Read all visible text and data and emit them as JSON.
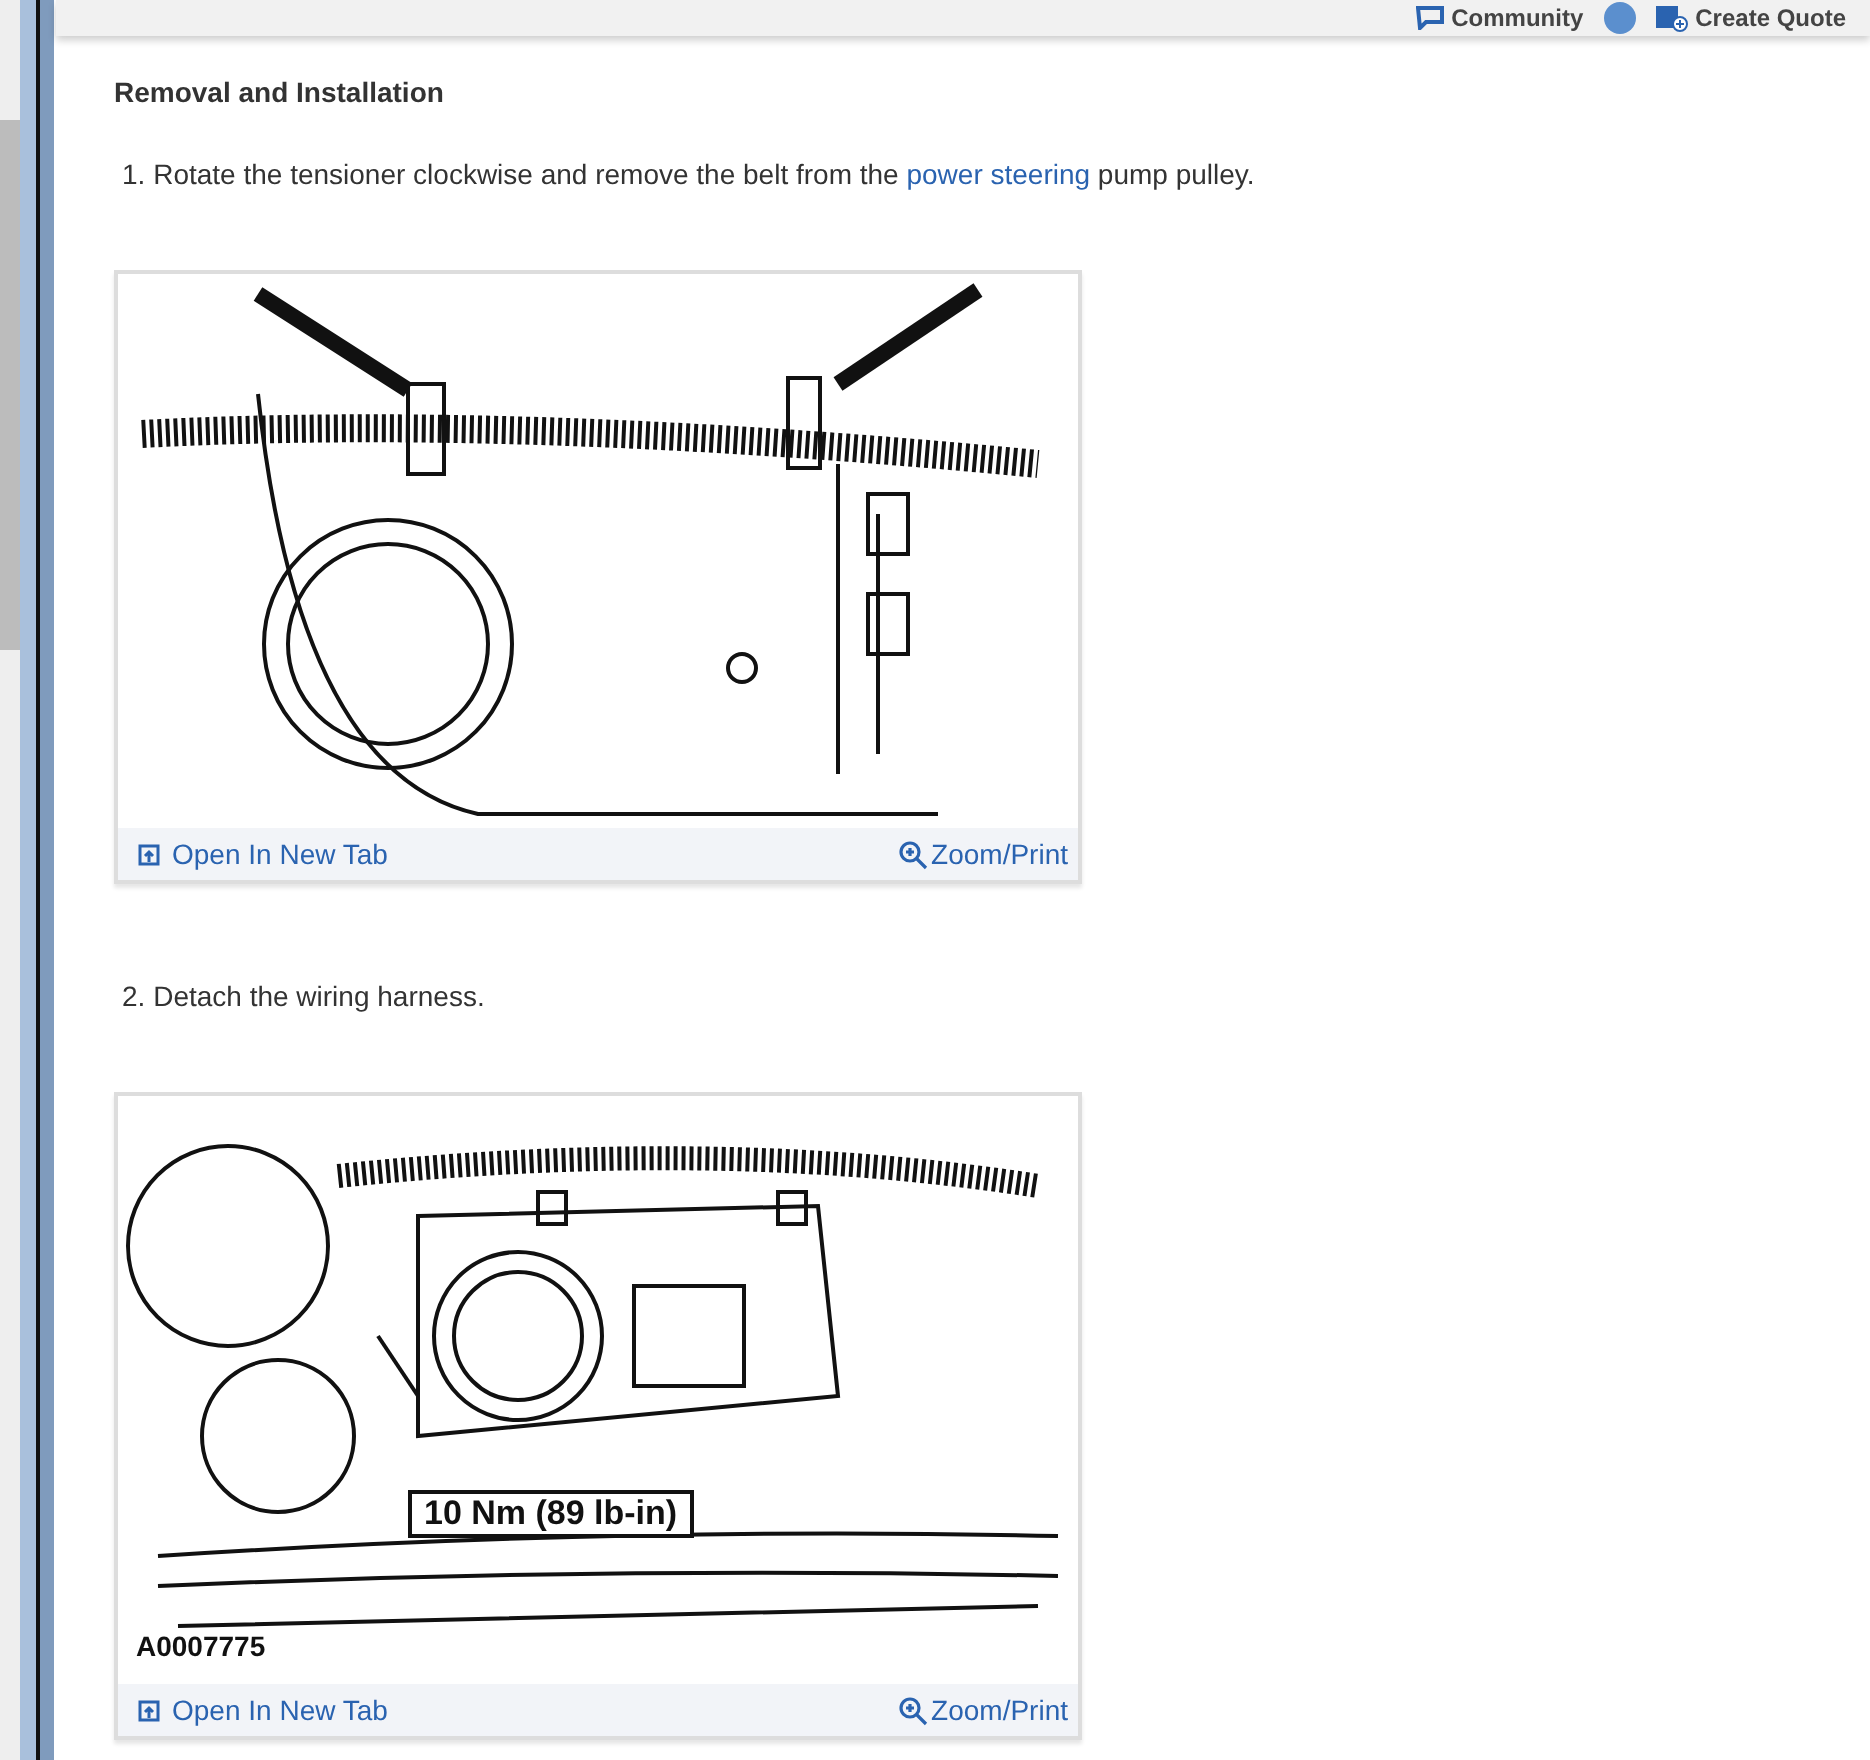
{
  "header": {
    "community": "Community",
    "create_quote": "Create Quote"
  },
  "section_title": "Removal and Installation",
  "steps": [
    {
      "number": "1.",
      "text_before": "Rotate the tensioner clockwise and remove the belt from the ",
      "link": "power steering",
      "text_after": " pump pulley.",
      "figure": {
        "kind": "belt",
        "open_tab": "Open In New Tab",
        "zoom": "Zoom/Print"
      }
    },
    {
      "number": "2.",
      "text_before": "Detach the wiring harness.",
      "figure": {
        "kind": "harness",
        "labels": [
          "10 Nm (89 lb-in)",
          "A0007775"
        ],
        "open_tab": "Open In New Tab",
        "zoom": "Zoom/Print"
      }
    }
  ]
}
